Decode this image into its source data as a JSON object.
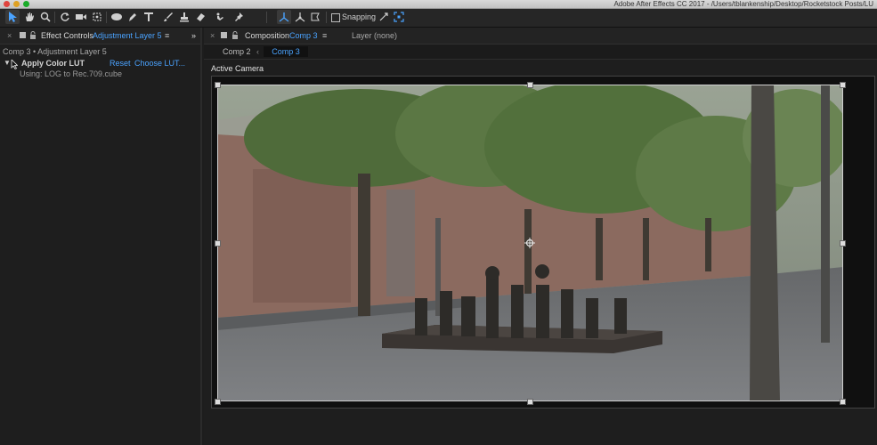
{
  "window": {
    "title": "Adobe After Effects CC 2017 - /Users/tblankenship/Desktop/Rocketstock Posts/LU"
  },
  "toolbar": {
    "tools": [
      "selection-tool",
      "hand-tool",
      "zoom-tool",
      "rotation-tool",
      "camera-tool",
      "pan-behind-tool",
      "ellipse-tool",
      "pen-tool",
      "type-tool",
      "brush-tool",
      "clone-stamp-tool",
      "eraser-tool",
      "roto-brush-tool",
      "puppet-pin-tool",
      "axis-local-tool",
      "axis-world-tool",
      "axis-view-tool"
    ],
    "snapping_label": "Snapping"
  },
  "effect_controls": {
    "tab_prefix": "Effect Controls",
    "tab_layer": "Adjustment Layer 5",
    "breadcrumb": "Comp 3 • Adjustment Layer 5",
    "effect_name": "Apply Color LUT",
    "reset_label": "Reset",
    "choose_label": "Choose LUT...",
    "using_text": "Using: LOG to Rec.709.cube"
  },
  "composition": {
    "tab_prefix": "Composition",
    "tab_comp": "Comp 3",
    "layer_tab": "Layer (none)",
    "subtabs": [
      "Comp 2",
      "Comp 3"
    ],
    "viewer_label": "Active Camera"
  },
  "colors": {
    "accent_blue": "#4aa3ff",
    "panel_bg": "#1e1e1e"
  }
}
